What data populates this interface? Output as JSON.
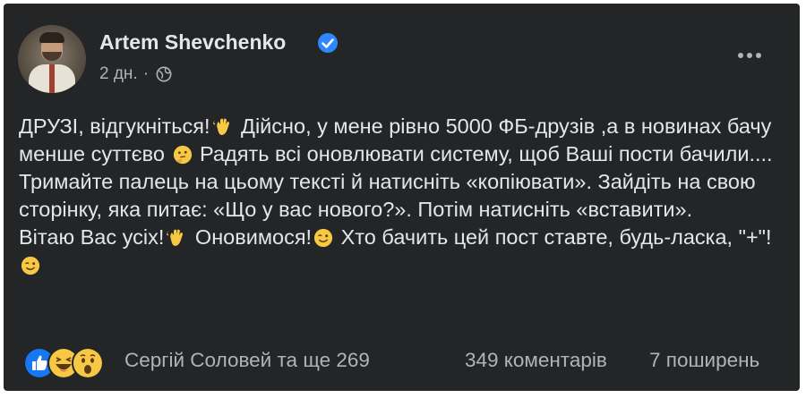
{
  "post": {
    "author": "Artem Shevchenko",
    "time": "2 дн.",
    "separator": "·",
    "text": {
      "p1_a": "ДРУЗІ, відгукніться!",
      "p1_b": " Дійсно, у мене рівно 5000 ФБ-друзів ,а в новинах бачу менше суттєво ",
      "p1_c": " Радять всі оновлювати систему, щоб Ваші пости бачили.... Тримайте палець на цьому тексті й натисніть «копіювати». Зайдіть на свою сторінку, яка питає: «Що у вас нового?». Потім натисніть «вставити».",
      "p2_a": "Вітаю Вас усіх!",
      "p2_b": " Оновимося!",
      "p2_c": " Хто бачить цей пост ставте, будь-ласка, \"+\"! "
    }
  },
  "footer": {
    "reactions_label": "Сергій Соловей та ще 269",
    "comments": "349 коментарів",
    "shares": "7 поширень"
  },
  "icons": {
    "verified": "verified-badge-icon",
    "privacy": "globe-icon",
    "more": "more-options-icon",
    "reactions": [
      "like-icon",
      "haha-icon",
      "wow-icon"
    ]
  },
  "colors": {
    "card_bg": "#242526",
    "text_primary": "#e4e6eb",
    "text_secondary": "#b0b3b8",
    "like_blue": "#1877f2",
    "verified_blue": "#2d88ff",
    "emoji_yellow": "#f7c844"
  }
}
